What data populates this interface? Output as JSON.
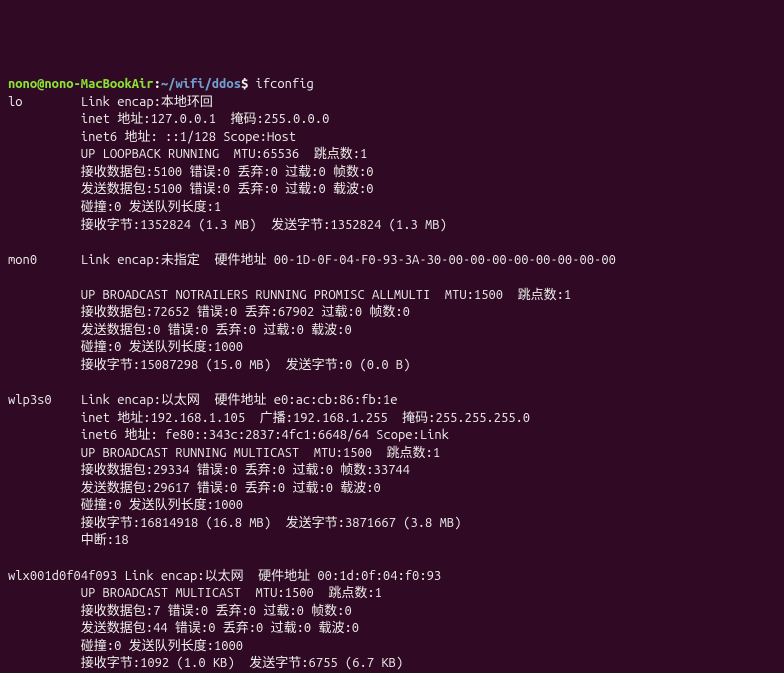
{
  "prompt": {
    "user_host": "nono@nono-MacBookAir",
    "sep1": ":",
    "cwd": "~/wifi/ddos",
    "sep2": "$ ",
    "command": "ifconfig"
  },
  "lo": {
    "iface": "lo",
    "pad": "        ",
    "l1": "Link encap:本地环回",
    "l2": "          inet 地址:127.0.0.1  掩码:255.0.0.0",
    "l3": "          inet6 地址: ::1/128 Scope:Host",
    "l4": "          UP LOOPBACK RUNNING  MTU:65536  跳点数:1",
    "l5": "          接收数据包:5100 错误:0 丢弃:0 过载:0 帧数:0",
    "l6": "          发送数据包:5100 错误:0 丢弃:0 过载:0 载波:0",
    "l7": "          碰撞:0 发送队列长度:1",
    "l8": "          接收字节:1352824 (1.3 MB)  发送字节:1352824 (1.3 MB)"
  },
  "mon0": {
    "iface": "mon0",
    "pad": "      ",
    "l1": "Link encap:未指定  硬件地址 00-1D-0F-04-F0-93-3A-30-00-00-00-00-00-00-00-00",
    "l2": "",
    "l3": "          UP BROADCAST NOTRAILERS RUNNING PROMISC ALLMULTI  MTU:1500  跳点数:1",
    "l4": "          接收数据包:72652 错误:0 丢弃:67902 过载:0 帧数:0",
    "l5": "          发送数据包:0 错误:0 丢弃:0 过载:0 载波:0",
    "l6": "          碰撞:0 发送队列长度:1000",
    "l7": "          接收字节:15087298 (15.0 MB)  发送字节:0 (0.0 B)"
  },
  "wlp3s0": {
    "iface": "wlp3s0",
    "pad": "    ",
    "l1": "Link encap:以太网  硬件地址 e0:ac:cb:86:fb:1e",
    "l2": "          inet 地址:192.168.1.105  广播:192.168.1.255  掩码:255.255.255.0",
    "l3": "          inet6 地址: fe80::343c:2837:4fc1:6648/64 Scope:Link",
    "l4": "          UP BROADCAST RUNNING MULTICAST  MTU:1500  跳点数:1",
    "l5": "          接收数据包:29334 错误:0 丢弃:0 过载:0 帧数:33744",
    "l6": "          发送数据包:29617 错误:0 丢弃:0 过载:0 载波:0",
    "l7": "          碰撞:0 发送队列长度:1000",
    "l8": "          接收字节:16814918 (16.8 MB)  发送字节:3871667 (3.8 MB)",
    "l9": "          中断:18"
  },
  "wlx": {
    "iface": "wlx001d0f04f093",
    "pad": " ",
    "l1": "Link encap:以太网  硬件地址 00:1d:0f:04:f0:93",
    "l2": "          UP BROADCAST MULTICAST  MTU:1500  跳点数:1",
    "l3": "          接收数据包:7 错误:0 丢弃:0 过载:0 帧数:0",
    "l4": "          发送数据包:44 错误:0 丢弃:0 过载:0 载波:0",
    "l5": "          碰撞:0 发送队列长度:1000",
    "l6": "          接收字节:1092 (1.0 KB)  发送字节:6755 (6.7 KB)"
  }
}
